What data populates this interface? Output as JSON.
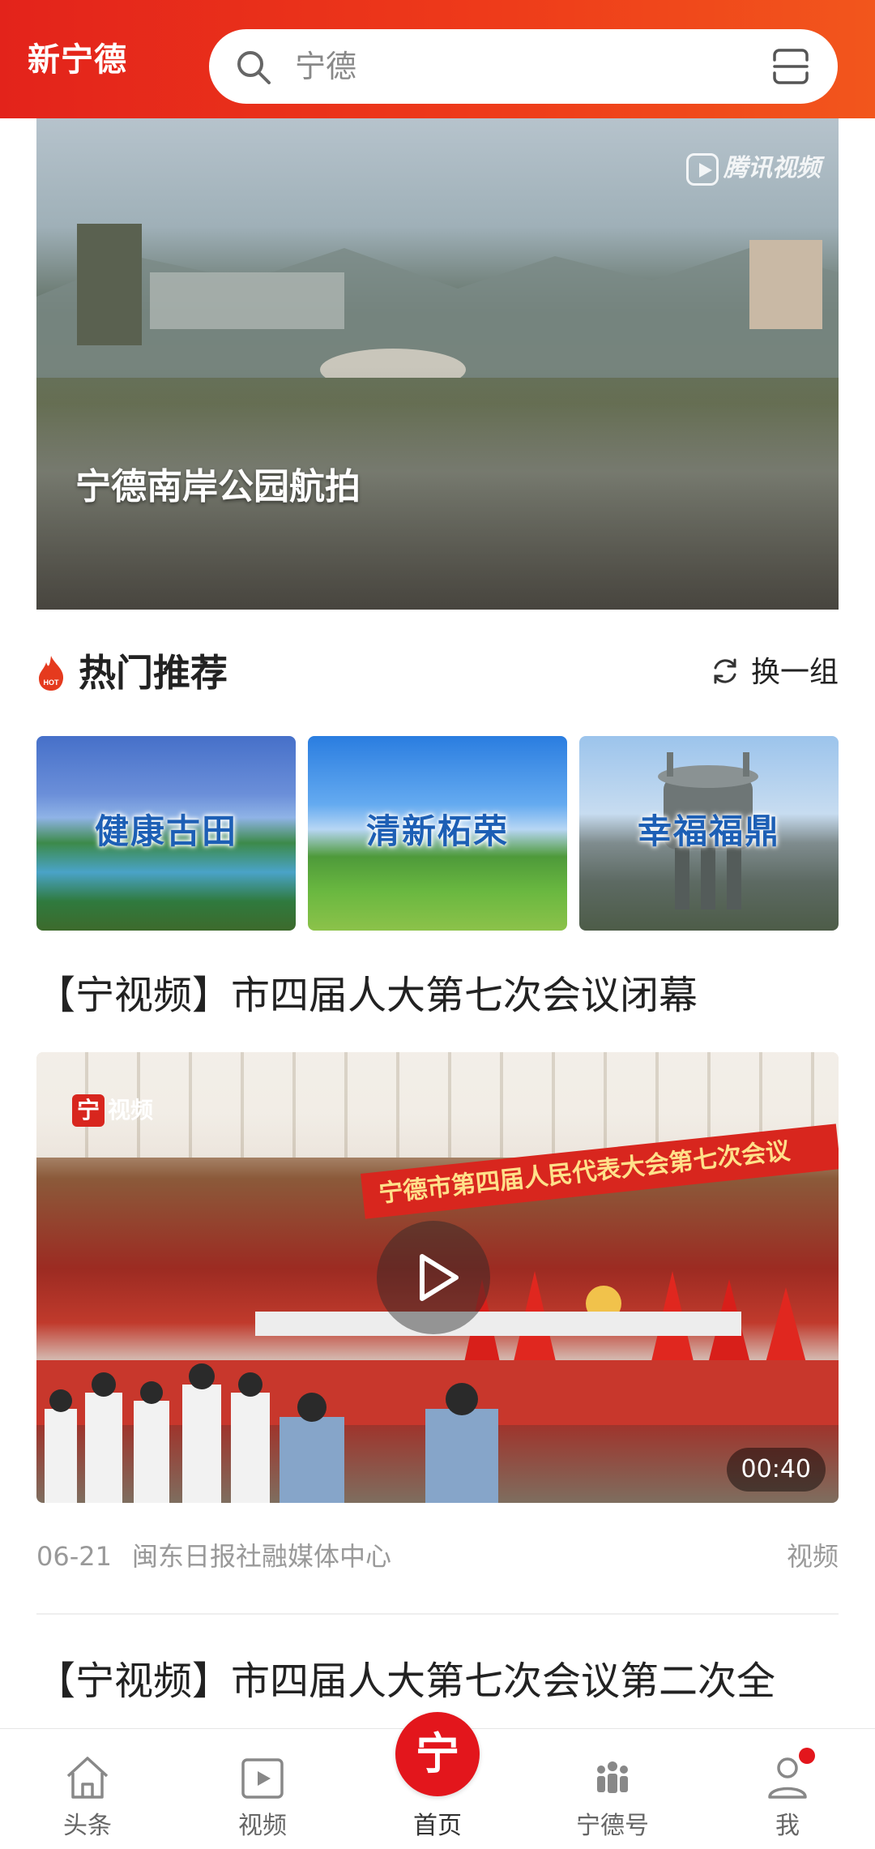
{
  "header": {
    "logo_text": "新宁德",
    "search_placeholder": "宁德",
    "search_icon": "search-icon",
    "scan_icon": "scan-icon"
  },
  "hero": {
    "title": "宁德南岸公园航拍",
    "watermark": "腾讯视频"
  },
  "hot": {
    "title": "热门推荐",
    "hot_badge": "HOT",
    "refresh_label": "换一组",
    "cards": [
      {
        "title": "健康古田"
      },
      {
        "title": "清新柘荣"
      },
      {
        "title": "幸福福鼎"
      }
    ]
  },
  "articles": [
    {
      "title": "【宁视频】市四届人大第七次会议闭幕",
      "video_logo": "视频",
      "video_logo_mark": "宁",
      "banner_text": "宁德市第四届人民代表大会第七次会议",
      "duration": "00:40",
      "date": "06-21",
      "source": "闽东日报社融媒体中心",
      "tag": "视频"
    },
    {
      "title": "【宁视频】市四届人大第七次会议第二次全"
    }
  ],
  "tabbar": {
    "items": [
      {
        "label": "头条",
        "icon": "home-icon"
      },
      {
        "label": "视频",
        "icon": "video-icon"
      },
      {
        "label": "首页",
        "icon": "ning-logo"
      },
      {
        "label": "宁德号",
        "icon": "people-icon"
      },
      {
        "label": "我",
        "icon": "user-icon"
      }
    ],
    "home_mark": "宁"
  },
  "colors": {
    "brand_red": "#e3231b",
    "accent_orange": "#f2561c",
    "card_text_blue": "#1d5fb5"
  }
}
